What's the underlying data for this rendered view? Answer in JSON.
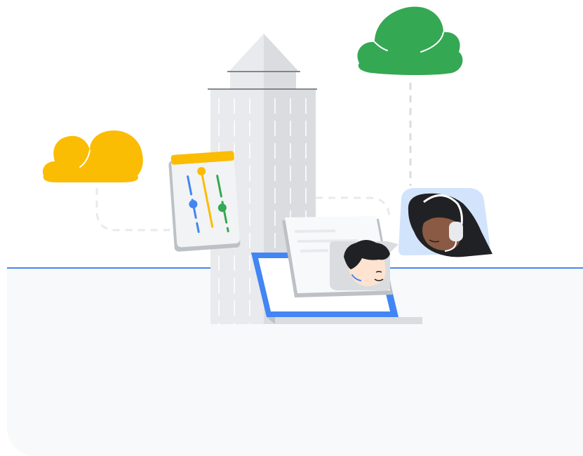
{
  "colors": {
    "cloud_left": "#fbbc04",
    "cloud_right": "#34a853",
    "horizon": "#4a86e8",
    "ground": "#f8f9fa",
    "building_light": "#e8eaed",
    "building_mid": "#dadce0",
    "building_dark": "#bdc1c6",
    "accent_blue": "#4285f4",
    "accent_yellow": "#fbbc04",
    "accent_green": "#34a853",
    "bubble_blue": "#d2e3fc"
  },
  "icons": {
    "cloud_left": "cloud-icon",
    "cloud_right": "cloud-icon",
    "settings_panel": "sliders-icon",
    "support_agent": "headset-icon",
    "chat_bubble": "chat-bubble-icon",
    "laptop": "laptop-icon",
    "building": "building-icon"
  }
}
